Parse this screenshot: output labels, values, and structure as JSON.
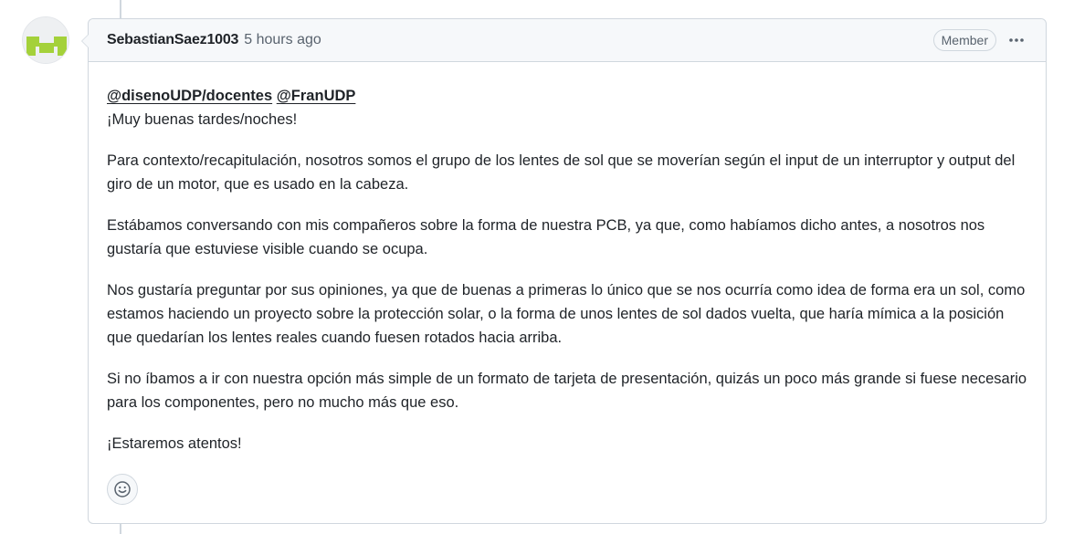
{
  "comment": {
    "author": "SebastianSaez1003",
    "timestamp": "5 hours ago",
    "role_badge": "Member",
    "mentions": [
      "@disenoUDP/docentes",
      "@FranUDP"
    ],
    "greeting": "¡Muy buenas tardes/noches!",
    "paragraphs": [
      "Para contexto/recapitulación, nosotros somos el grupo de los lentes de sol que se moverían según el input de un interruptor y output del giro de un motor, que es usado en la cabeza.",
      "Estábamos conversando con mis compañeros sobre la forma de nuestra PCB, ya que, como habíamos dicho antes, a nosotros nos gustaría que estuviese visible cuando se ocupa.",
      "Nos gustaría preguntar por sus opiniones, ya que de buenas a primeras lo único que se nos ocurría como idea de forma era un sol, como estamos haciendo un proyecto sobre la protección solar, o la forma de unos lentes de sol dados vuelta, que haría mímica a la posición que quedarían los lentes reales cuando fuesen rotados hacia arriba.",
      "Si no íbamos a ir con nuestra opción más simple de un formato de tarjeta de presentación, quizás un poco más grande si fuese necesario para los componentes, pero no mucho más que eso.",
      "¡Estaremos atentos!"
    ],
    "icons": {
      "avatar": "identicon-avatar",
      "more": "kebab-horizontal-icon",
      "reaction": "smiley-icon"
    },
    "colors": {
      "avatar_fill": "#a4d13a",
      "border": "#d0d7de",
      "header_bg": "#f6f8fa"
    }
  }
}
